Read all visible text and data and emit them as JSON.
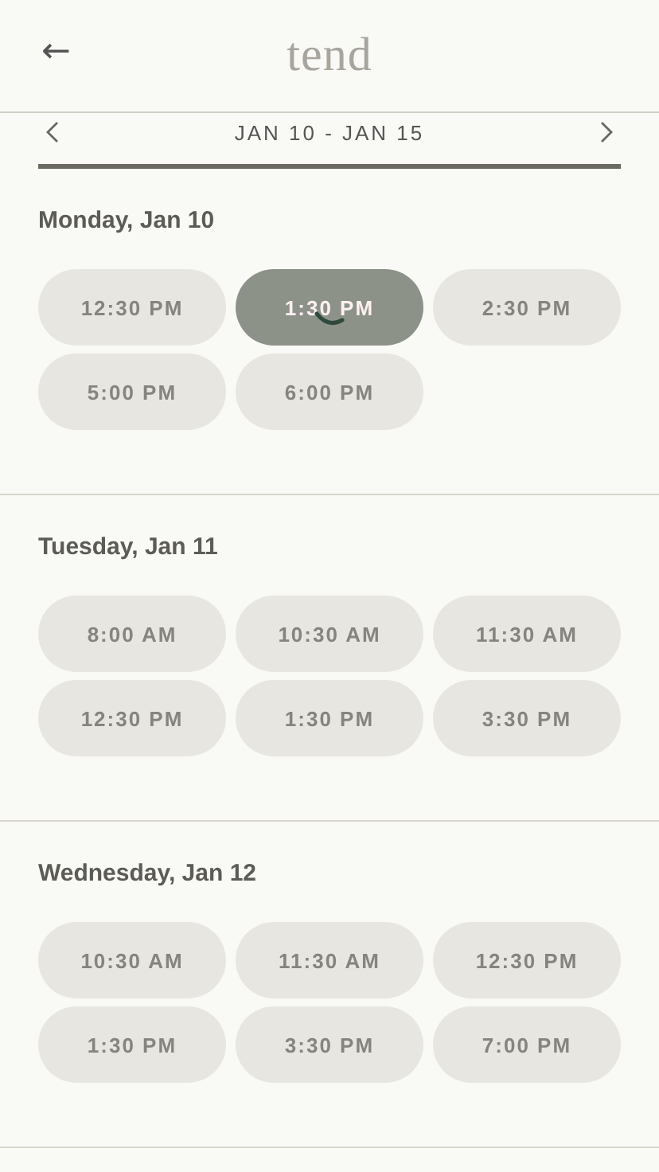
{
  "header": {
    "back": "←",
    "logo": "tend"
  },
  "week": {
    "label": "JAN 10 - JAN 15"
  },
  "days": [
    {
      "title": "Monday, Jan 10",
      "slots": [
        {
          "time": "12:30 PM",
          "selected": false
        },
        {
          "time": "1:30 PM",
          "selected": true
        },
        {
          "time": "2:30 PM",
          "selected": false
        },
        {
          "time": "5:00 PM",
          "selected": false
        },
        {
          "time": "6:00 PM",
          "selected": false
        }
      ]
    },
    {
      "title": "Tuesday, Jan 11",
      "slots": [
        {
          "time": "8:00 AM",
          "selected": false
        },
        {
          "time": "10:30 AM",
          "selected": false
        },
        {
          "time": "11:30 AM",
          "selected": false
        },
        {
          "time": "12:30 PM",
          "selected": false
        },
        {
          "time": "1:30 PM",
          "selected": false
        },
        {
          "time": "3:30 PM",
          "selected": false
        }
      ]
    },
    {
      "title": "Wednesday, Jan 12",
      "slots": [
        {
          "time": "10:30 AM",
          "selected": false
        },
        {
          "time": "11:30 AM",
          "selected": false
        },
        {
          "time": "12:30 PM",
          "selected": false
        },
        {
          "time": "1:30 PM",
          "selected": false
        },
        {
          "time": "3:30 PM",
          "selected": false
        },
        {
          "time": "7:00 PM",
          "selected": false
        }
      ]
    }
  ]
}
